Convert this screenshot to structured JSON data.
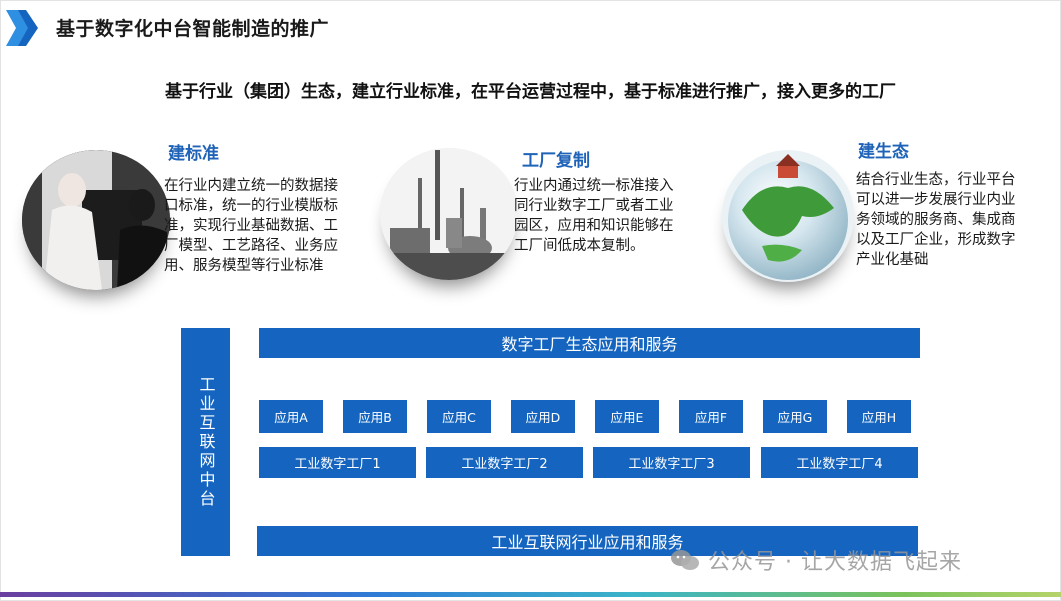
{
  "title": "基于数字化中台智能制造的推广",
  "subtitle": "基于行业（集团）生态，建立行业标准，在平台运营过程中，基于标准进行推广，接入更多的工厂",
  "sections": [
    {
      "heading": "建标准",
      "lines": [
        "在行业内建立统一的数据接",
        "口标准，统一的行业模版标",
        "准，实现行业基础数据、工",
        "厂模型、工艺路径、业务应",
        "用、服务模型等行业标准"
      ]
    },
    {
      "heading": "工厂复制",
      "lines": [
        "行业内通过统一标准接入",
        "同行业数字工厂或者工业",
        "园区，应用和知识能够在",
        "工厂间低成本复制。"
      ]
    },
    {
      "heading": "建生态",
      "lines": [
        "结合行业生态，行业平台",
        "可以进一步发展行业内业",
        "务领域的服务商、集成商",
        "以及工厂企业，形成数字",
        "产业化基础"
      ]
    }
  ],
  "diagram": {
    "platform_label": "工业互联网中台",
    "top_bar": "数字工厂生态应用和服务",
    "apps": [
      "应用A",
      "应用B",
      "应用C",
      "应用D",
      "应用E",
      "应用F",
      "应用G",
      "应用H"
    ],
    "factories": [
      "工业数字工厂1",
      "工业数字工厂2",
      "工业数字工厂3",
      "工业数字工厂4"
    ],
    "bottom_bar": "工业互联网行业应用和服务"
  },
  "watermark": "公众号 · 让大数据飞起来",
  "colors": {
    "accent_blue": "#1565c0",
    "heading_blue": "#1f63b8"
  }
}
